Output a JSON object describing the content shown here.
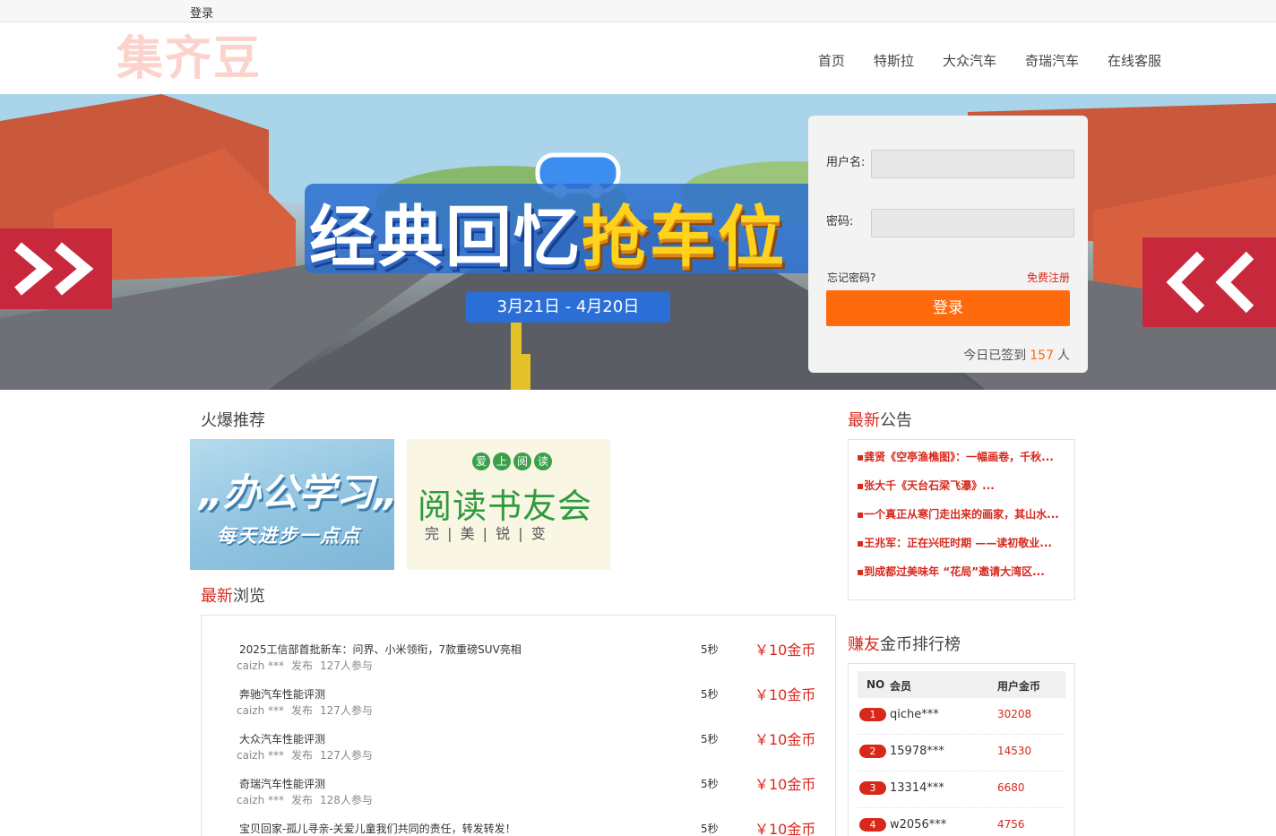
{
  "topbar": {
    "login": "登录"
  },
  "header": {
    "logo": "集齐豆",
    "nav": [
      "首页",
      "特斯拉",
      "大众汽车",
      "奇瑞汽车",
      "在线客服"
    ]
  },
  "banner": {
    "title_part1": "经典回忆",
    "title_part2": "抢车位",
    "date": "3月21日 - 4月20日"
  },
  "login": {
    "username_label": "用户名:",
    "password_label": "密码:",
    "forgot": "忘记密码?",
    "register": "免费注册",
    "submit": "登录",
    "signin_prefix": "今日已签到",
    "signin_count": "157",
    "signin_suffix": "人"
  },
  "hot": {
    "title": "火爆推荐",
    "promo1": {
      "line1": "„办公学习„",
      "line2": "每天进步一点点"
    },
    "promo2": {
      "tags": [
        "爱",
        "上",
        "阅",
        "读"
      ],
      "line1": "阅读书友会",
      "line2": "完 | 美 | 锐 | 变"
    }
  },
  "browse": {
    "title_red": "最新",
    "title_rest": "浏览",
    "items": [
      {
        "title": "2025工信部首批新车：问界、小米领衔，7款重磅SUV亮相",
        "user": "caizh ***",
        "action": "发布",
        "participants": "127人参与",
        "duration": "5秒",
        "price": "￥10金币"
      },
      {
        "title": "奔驰汽车性能评测",
        "user": "caizh ***",
        "action": "发布",
        "participants": "127人参与",
        "duration": "5秒",
        "price": "￥10金币"
      },
      {
        "title": "大众汽车性能评测",
        "user": "caizh ***",
        "action": "发布",
        "participants": "127人参与",
        "duration": "5秒",
        "price": "￥10金币"
      },
      {
        "title": "奇瑞汽车性能评测",
        "user": "caizh ***",
        "action": "发布",
        "participants": "128人参与",
        "duration": "5秒",
        "price": "￥10金币"
      },
      {
        "title": "宝贝回家-孤儿寻亲-关爱儿童我们共同的责任，转发转发！",
        "user": "",
        "action": "",
        "participants": "",
        "duration": "5秒",
        "price": "￥10金币"
      }
    ]
  },
  "notice": {
    "title_red": "最新",
    "title_rest": "公告",
    "items": [
      "▪龚贤《空亭渔樵图》：一幅画卷，千秋...",
      "▪张大千《天台石梁飞瀑》...",
      "▪一个真正从寒门走出来的画家，其山水...",
      "▪王兆军：正在兴旺时期 ——读初敬业...",
      "▪到成都过美味年 “花局”邀请大湾区..."
    ]
  },
  "rank": {
    "title_red": "赚友",
    "title_rest": "金币排行榜",
    "col_no": "NO",
    "col_member": "会员",
    "col_coins": "用户金币",
    "rows": [
      {
        "no": "1",
        "user": "qiche***",
        "coins": "30208"
      },
      {
        "no": "2",
        "user": "15978***",
        "coins": "14530"
      },
      {
        "no": "3",
        "user": "13314***",
        "coins": "6680"
      },
      {
        "no": "4",
        "user": "w2056***",
        "coins": "4756"
      }
    ]
  },
  "colors": {
    "accent": "#ff6a0d",
    "red": "#d8281c",
    "logo": "#fbd3cc"
  }
}
